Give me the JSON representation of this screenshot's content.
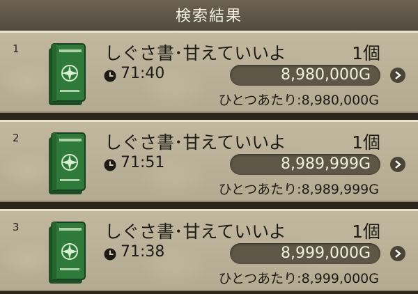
{
  "header": {
    "title": "検索結果"
  },
  "results": [
    {
      "index": "1",
      "name": "しぐさ書･甘えていいよ",
      "quantity": "1個",
      "time_left": "71:40",
      "price": "8,980,000G",
      "unit_price": "ひとつあたり:8,980,000G"
    },
    {
      "index": "2",
      "name": "しぐさ書･甘えていいよ",
      "quantity": "1個",
      "time_left": "71:51",
      "price": "8,989,999G",
      "unit_price": "ひとつあたり:8,989,999G"
    },
    {
      "index": "3",
      "name": "しぐさ書･甘えていいよ",
      "quantity": "1個",
      "time_left": "71:38",
      "price": "8,999,000G",
      "unit_price": "ひとつあたり:8,999,000G"
    }
  ],
  "colors": {
    "header_bg": "#5e5647",
    "row_bg": "#bdb49b",
    "price_pill": "#5e5647",
    "book_green": "#2f7a3a",
    "text_dark": "#1e1b15",
    "text_light": "#f4efe2"
  },
  "icons": {
    "item": "green-book-icon",
    "time": "clock-icon",
    "detail": "chevron-right-icon"
  }
}
